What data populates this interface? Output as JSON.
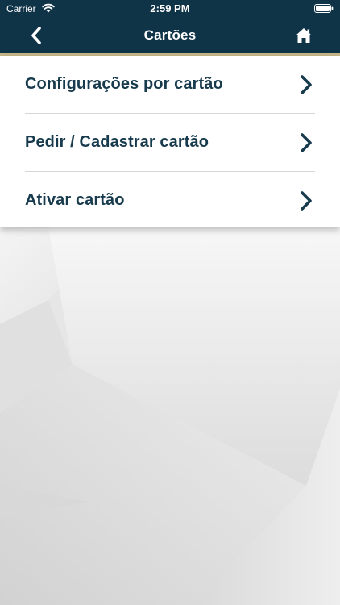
{
  "status_bar": {
    "carrier": "Carrier",
    "time": "2:59 PM",
    "wifi_icon": "wifi-icon",
    "battery_icon": "battery-full-icon"
  },
  "nav": {
    "title": "Cartões",
    "back_icon": "chevron-left-icon",
    "home_icon": "home-icon"
  },
  "menu": {
    "items": [
      {
        "label": "Configurações por cartão"
      },
      {
        "label": "Pedir / Cadastrar cartão"
      },
      {
        "label": "Ativar cartão"
      }
    ]
  },
  "colors": {
    "nav_background": "#0f3347",
    "accent_line": "#c9b98a",
    "menu_text": "#173a4d",
    "divider": "#d6d6d6",
    "background": "#ededed"
  }
}
